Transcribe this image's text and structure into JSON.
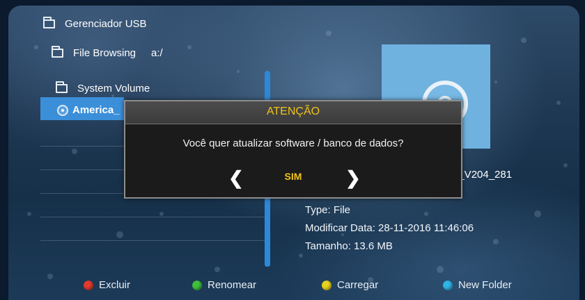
{
  "nav": {
    "title": "Gerenciador USB",
    "browsing_label": "File Browsing",
    "path": "a:/"
  },
  "files": [
    {
      "label": "System Volume",
      "type": "folder"
    },
    {
      "label": "America_",
      "type": "disc",
      "selected": true
    }
  ],
  "preview": {
    "filename_tail": "5_V204_281",
    "type": "Type: File",
    "modified": "Modificar Data: 28-11-2016 11:46:06",
    "size": "Tamanho: 13.6 MB"
  },
  "dialog": {
    "title": "ATENÇÃO",
    "message": "Você quer atualizar software / banco de dados?",
    "left_arrow": "❮",
    "right_arrow": "❯",
    "value": "SIM"
  },
  "footer": [
    {
      "label": "Excluir",
      "color": "#e23b2e"
    },
    {
      "label": "Renomear",
      "color": "#3fbf3a"
    },
    {
      "label": "Carregar",
      "color": "#e8d21f"
    },
    {
      "label": "New Folder",
      "color": "#2fb6e6"
    }
  ],
  "colors": {
    "accent_yellow": "#f0c419",
    "selection_blue": "#3b8fd9"
  }
}
